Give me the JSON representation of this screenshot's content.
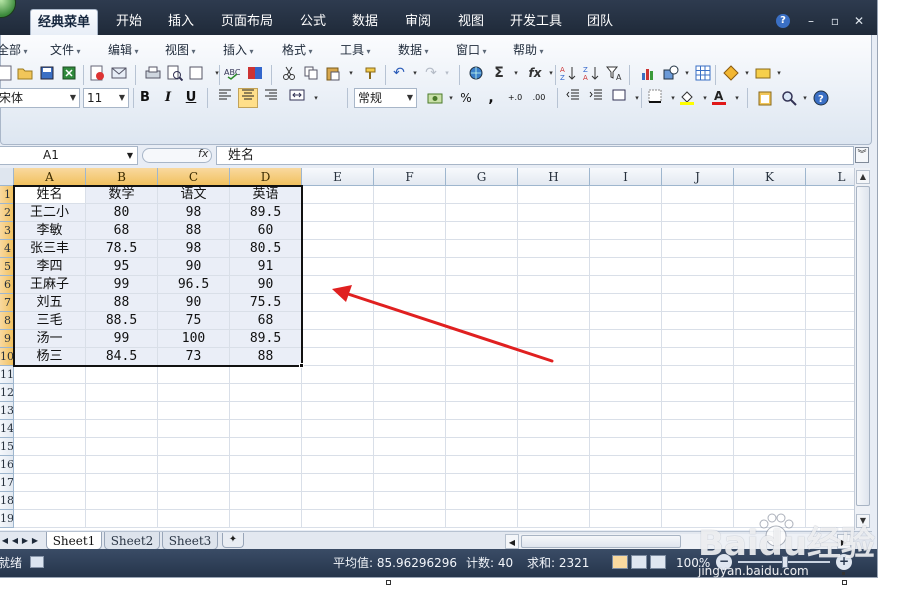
{
  "tabs": [
    {
      "label": "经典菜单",
      "active": true
    },
    {
      "label": "开始"
    },
    {
      "label": "插入"
    },
    {
      "label": "页面布局"
    },
    {
      "label": "公式"
    },
    {
      "label": "数据"
    },
    {
      "label": "审阅"
    },
    {
      "label": "视图"
    },
    {
      "label": "开发工具"
    },
    {
      "label": "团队"
    }
  ],
  "window_controls": {
    "help": "?",
    "minimize": "–",
    "restore": "▫",
    "close": "✕"
  },
  "menubar": [
    "全部",
    "文件",
    "编辑",
    "视图",
    "插入",
    "格式",
    "工具",
    "数据",
    "窗口",
    "帮助"
  ],
  "format": {
    "font_name": "宋体",
    "font_size": "11",
    "bold": "B",
    "italic": "I",
    "underline": "U",
    "number_format": "常规",
    "percent": "%",
    "comma": ",",
    "inc_decimal": "+.0",
    "dec_decimal": ".00"
  },
  "formula_bar": {
    "name_box": "A1",
    "fx": "fx",
    "content": "姓名"
  },
  "columns": [
    "A",
    "B",
    "C",
    "D",
    "E",
    "F",
    "G",
    "H",
    "I",
    "J",
    "K",
    "L"
  ],
  "rows": [
    "1",
    "2",
    "3",
    "4",
    "5",
    "6",
    "7",
    "8",
    "9",
    "10",
    "11",
    "12",
    "13",
    "14",
    "15",
    "16",
    "17",
    "18",
    "19"
  ],
  "table": {
    "header": [
      "姓名",
      "数学",
      "语文",
      "英语"
    ],
    "rows": [
      [
        "王二小",
        "80",
        "98",
        "89.5"
      ],
      [
        "李敏",
        "68",
        "88",
        "60"
      ],
      [
        "张三丰",
        "78.5",
        "98",
        "80.5"
      ],
      [
        "李四",
        "95",
        "90",
        "91"
      ],
      [
        "王麻子",
        "99",
        "96.5",
        "90"
      ],
      [
        "刘五",
        "88",
        "90",
        "75.5"
      ],
      [
        "三毛",
        "88.5",
        "75",
        "68"
      ],
      [
        "汤一",
        "99",
        "100",
        "89.5"
      ],
      [
        "杨三",
        "84.5",
        "73",
        "88"
      ]
    ]
  },
  "sheets": [
    {
      "label": "Sheet1",
      "active": true
    },
    {
      "label": "Sheet2"
    },
    {
      "label": "Sheet3"
    }
  ],
  "status": {
    "ready": "就绪",
    "average": "平均值: 85.96296296",
    "count": "计数: 40",
    "sum": "求和: 2321",
    "zoom": "100%"
  },
  "watermark": {
    "logo": "Baidu经验",
    "url": "jingyan.baidu.com"
  },
  "colors": {
    "accent_selection": "#f1c15f",
    "annotation_arrow": "#e02020",
    "tabbar": "#2e3b4f",
    "statusbar": "#2f3f57"
  }
}
